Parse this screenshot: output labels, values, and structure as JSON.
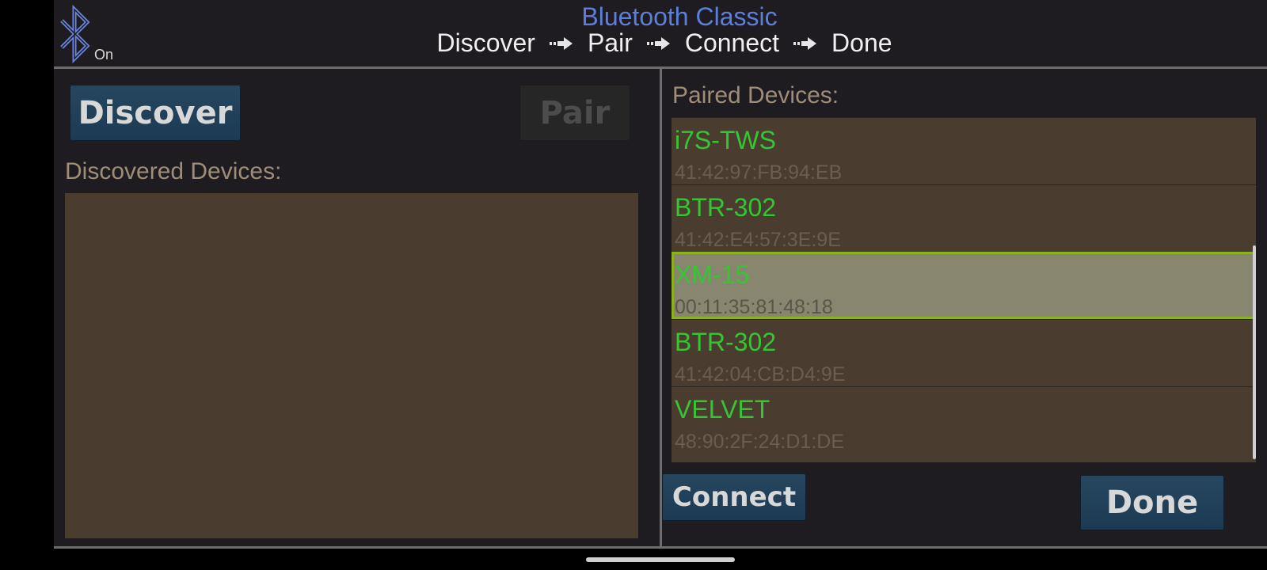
{
  "header": {
    "bluetooth_status": "On",
    "title": "Bluetooth Classic",
    "steps": [
      "Discover",
      "Pair",
      "Connect",
      "Done"
    ]
  },
  "left_panel": {
    "discover_button": "Discover",
    "pair_button": "Pair",
    "discovered_label": "Discovered Devices:"
  },
  "right_panel": {
    "paired_label": "Paired Devices:",
    "devices": [
      {
        "name": "i7S-TWS",
        "address": "41:42:97:FB:94:EB"
      },
      {
        "name": "BTR-302",
        "address": "41:42:E4:57:3E:9E"
      },
      {
        "name": "XM-15",
        "address": "00:11:35:81:48:18"
      },
      {
        "name": "BTR-302",
        "address": "41:42:04:CB:D4:9E"
      },
      {
        "name": "VELVET",
        "address": "48:90:2F:24:D1:DE"
      }
    ],
    "selected_index": 2,
    "connect_button": "Connect",
    "done_button": "Done"
  },
  "colors": {
    "title": "#5b7fdc",
    "device_name": "#35c633",
    "selection_border": "#8bb21e",
    "list_background": "#4a3d30"
  },
  "icons": {
    "bluetooth": "bluetooth-icon",
    "step_arrow": "right-arrow-icon"
  }
}
